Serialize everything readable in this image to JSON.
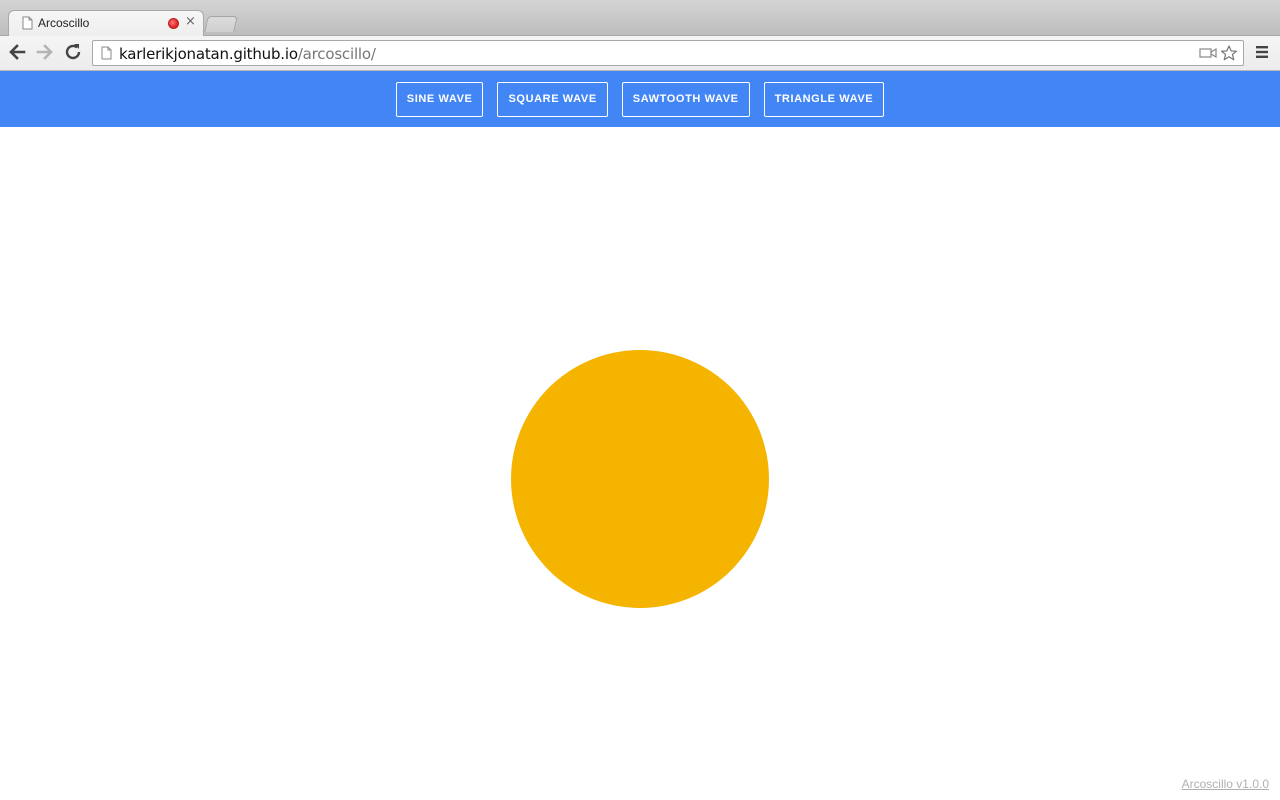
{
  "browser": {
    "tab": {
      "title": "Arcoscillo",
      "favicon": "page-icon",
      "recording_indicator": "record-icon",
      "close_icon": "close-icon"
    },
    "omnibox": {
      "host": "karlerikjonatan.github.io",
      "path": "/arcoscillo/",
      "icons": [
        "camera-icon",
        "star-icon"
      ]
    },
    "nav_icons": [
      "back-arrow-icon",
      "forward-arrow-icon",
      "reload-icon"
    ],
    "menu_icon": "hamburger-menu-icon"
  },
  "app": {
    "header_color": "#4286f6",
    "wave_buttons": [
      {
        "label": "SINE WAVE"
      },
      {
        "label": "SQUARE WAVE"
      },
      {
        "label": "SAWTOOTH WAVE"
      },
      {
        "label": "TRIANGLE WAVE"
      }
    ],
    "orb_color": "#f4b400",
    "version_link": "Arcoscillo v1.0.0"
  }
}
